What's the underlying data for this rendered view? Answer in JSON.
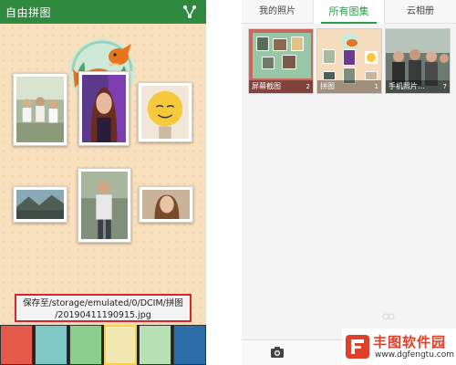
{
  "left_app": {
    "title": "自由拼图",
    "share_icon": "share-icon",
    "save_toast": {
      "line1": "保存至/storage/emulated/0/DCIM/拼图",
      "line2": "/20190411190915.jpg"
    },
    "colors": {
      "header": "#2f8a3f",
      "background": "#f8e0bf",
      "toast_border": "#d9262b"
    }
  },
  "right_app": {
    "tabs": [
      {
        "label": "我的照片"
      },
      {
        "label": "所有图集"
      },
      {
        "label": "云相册"
      }
    ],
    "albums": [
      {
        "name": "屏幕截图",
        "count": "2"
      },
      {
        "name": "拼图",
        "count": "1"
      },
      {
        "name": "手机照片…",
        "count": "7"
      }
    ],
    "camera_icon": "camera-icon",
    "colors": {
      "active_tab": "#2f9a48"
    }
  },
  "watermark": {
    "name": "丰图软件园",
    "url": "www.dgfengtu.com"
  }
}
